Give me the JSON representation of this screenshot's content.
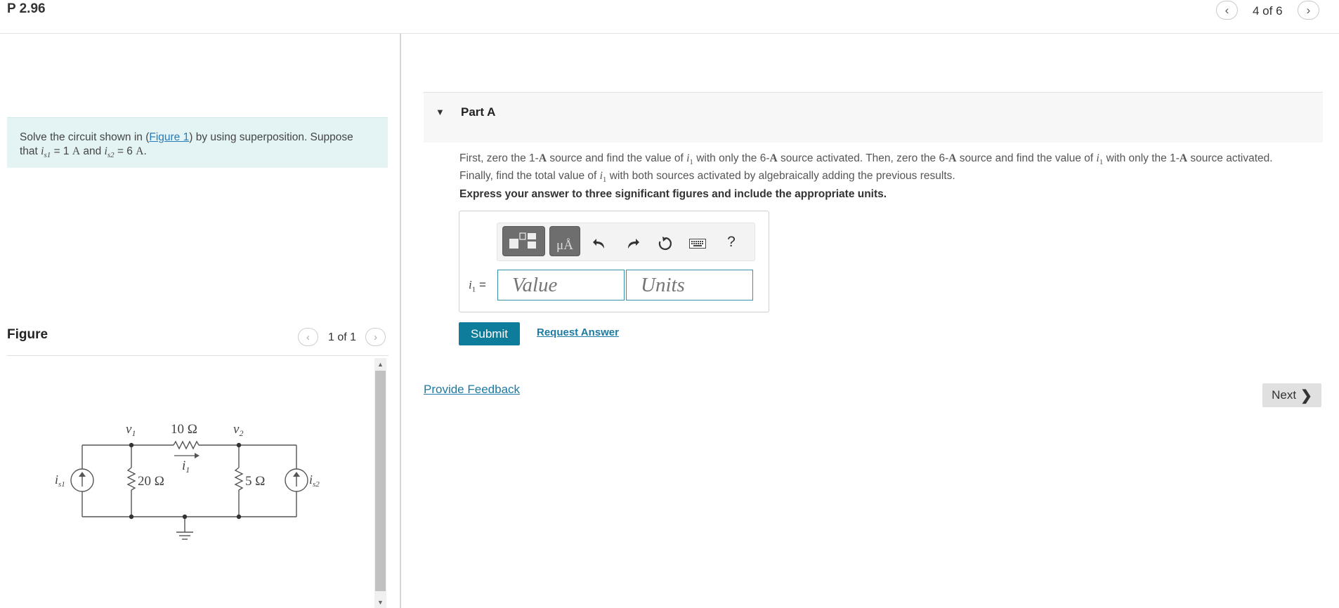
{
  "header": {
    "title": "P 2.96",
    "pager_text": "4 of 6"
  },
  "problem": {
    "text_before": "Solve the circuit shown in (",
    "figure_link": "Figure 1",
    "text_after": ") by using superposition. Suppose",
    "line2_that": "that ",
    "is1_symbol": "i",
    "is1_sub": "s1",
    "is1_value": " = 1 ",
    "unit_A": "A",
    "and": " and ",
    "is2_symbol": "i",
    "is2_sub": "s2",
    "is2_value": " = 6 ",
    "period": "."
  },
  "figure": {
    "label": "Figure",
    "pager_text": "1 of 1"
  },
  "circuit": {
    "v1": "v",
    "v1_sub": "1",
    "v2": "v",
    "v2_sub": "2",
    "r10": "10 Ω",
    "r20": "20 Ω",
    "r5": "5 Ω",
    "i1": "i",
    "i1_sub": "1",
    "is1": "i",
    "is1_sub": "s1",
    "is2": "i",
    "is2_sub": "s2"
  },
  "part": {
    "title": "Part A",
    "instructions": {
      "s1": "First, zero the 1-",
      "A": "A",
      "s2": " source and find the value of ",
      "i": "i",
      "sub": "1",
      "s3": " with only the 6-",
      "s4": " source activated. Then, zero the 6-",
      "s5": " source and find the value of ",
      "s6": " with only the 1-",
      "s7": " source activated. Finally, find the total value of ",
      "s8": " with both sources activated by algebraically adding the previous results."
    },
    "express": "Express your answer to three significant figures and include the appropriate units."
  },
  "answer": {
    "label_i": "i",
    "label_sub": "1",
    "label_eq": " =",
    "value_placeholder": "Value",
    "units_placeholder": "Units",
    "units_tool": "μÅ",
    "help": "?"
  },
  "actions": {
    "submit": "Submit",
    "request_answer": "Request Answer",
    "provide_feedback": "Provide Feedback",
    "next": "Next"
  },
  "colors": {
    "accent": "#0e7c9b",
    "link": "#1d7aa0",
    "problem_bg": "#e4f4f5"
  }
}
